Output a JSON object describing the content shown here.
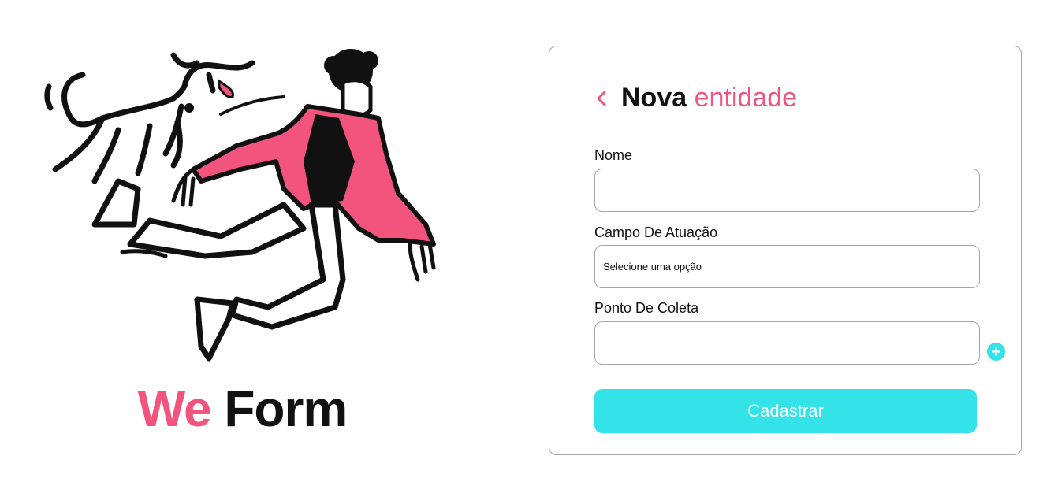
{
  "brand": {
    "word1": "We",
    "word2": "Form"
  },
  "form": {
    "title_part1": "Nova",
    "title_part2": "entidade",
    "fields": {
      "name": {
        "label": "Nome",
        "value": "",
        "placeholder": ""
      },
      "field_of_action": {
        "label": "Campo De Atuação",
        "selected": "Selecione uma opção"
      },
      "collection_point": {
        "label": "Ponto De Coleta",
        "value": "",
        "placeholder": ""
      }
    },
    "submit_label": "Cadastrar"
  },
  "icons": {
    "back": "chevron-left-icon",
    "add": "plus-circle-icon",
    "illustration": "person-running-with-dog-illustration"
  },
  "colors": {
    "accent_pink": "#f2547d",
    "accent_cyan": "#34e3e8",
    "text": "#111111",
    "border": "#a5a5a5"
  }
}
